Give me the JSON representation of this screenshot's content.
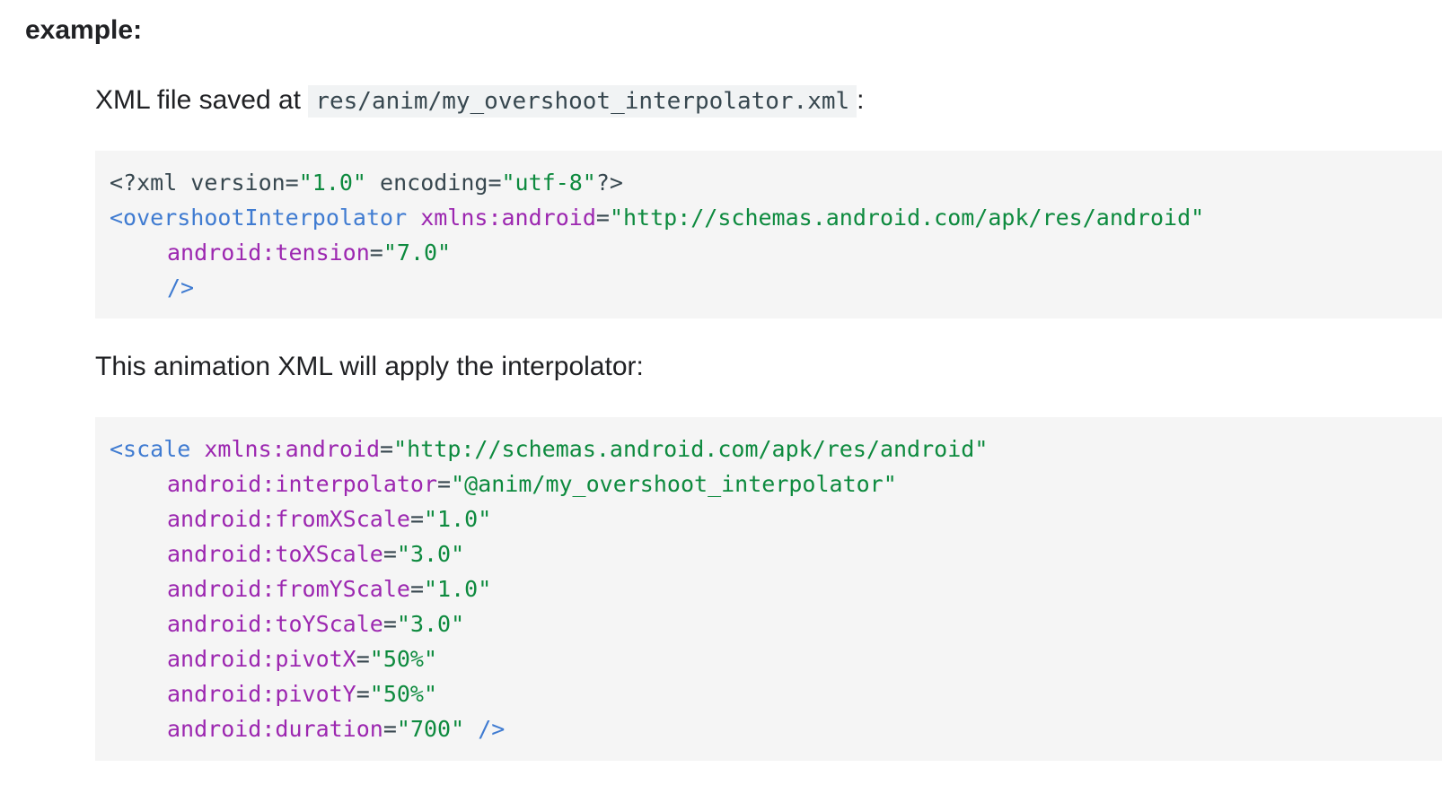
{
  "heading": "example:",
  "para1": {
    "prefix": "XML file saved at",
    "path": "res/anim/my_overshoot_interpolator.xml",
    "suffix": ":"
  },
  "code1": {
    "line1": {
      "open": "<?xml version=",
      "version": "\"1.0\"",
      "enc_attr": " encoding=",
      "enc_val": "\"utf-8\"",
      "close": "?>"
    },
    "line2": {
      "tag": "<overshootInterpolator",
      "attr": "xmlns:android",
      "eq": "=",
      "val": "\"http://schemas.android.com/apk/res/android\""
    },
    "line3": {
      "attr": "android:tension",
      "eq": "=",
      "val": "\"7.0\""
    },
    "line4": {
      "tag": "/>"
    }
  },
  "para2": {
    "text": "This animation XML will apply the interpolator:"
  },
  "code2": {
    "line1": {
      "tag": "<scale",
      "attr": "xmlns:android",
      "eq": "=",
      "val": "\"http://schemas.android.com/apk/res/android\""
    },
    "attrs": [
      {
        "attr": "android:interpolator",
        "eq": "=",
        "val": "\"@anim/my_overshoot_interpolator\""
      },
      {
        "attr": "android:fromXScale",
        "eq": "=",
        "val": "\"1.0\""
      },
      {
        "attr": "android:toXScale",
        "eq": "=",
        "val": "\"3.0\""
      },
      {
        "attr": "android:fromYScale",
        "eq": "=",
        "val": "\"1.0\""
      },
      {
        "attr": "android:toYScale",
        "eq": "=",
        "val": "\"3.0\""
      },
      {
        "attr": "android:pivotX",
        "eq": "=",
        "val": "\"50%\""
      },
      {
        "attr": "android:pivotY",
        "eq": "=",
        "val": "\"50%\""
      },
      {
        "attr": "android:duration",
        "eq": "=",
        "val": "\"700\""
      }
    ],
    "close_tag": "/>"
  }
}
